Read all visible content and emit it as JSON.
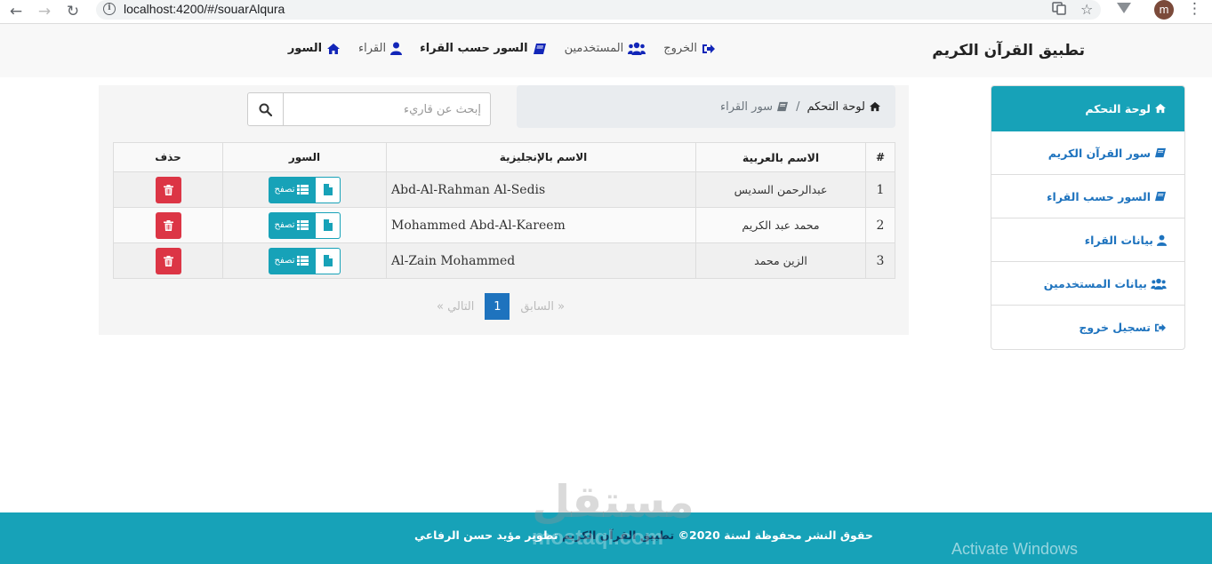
{
  "browser": {
    "url": "localhost:4200/#/souarAlqura",
    "avatar_letter": "m"
  },
  "navbar": {
    "brand": "تطبيق القرآن الكريم",
    "links": [
      {
        "label": "السور",
        "icon": "home-icon",
        "bold": true
      },
      {
        "label": "القراء",
        "icon": "user-icon",
        "bold": false
      },
      {
        "label": "السور حسب القراء",
        "icon": "book-icon",
        "bold": true
      },
      {
        "label": "المستخدمين",
        "icon": "users-icon",
        "bold": false
      },
      {
        "label": "الخروج",
        "icon": "sign-out-icon",
        "bold": false
      }
    ]
  },
  "sidebar": {
    "items": [
      {
        "label": "لوحة التحكم",
        "icon": "home-icon",
        "active": true
      },
      {
        "label": "سور القرآن الكريم",
        "icon": "book-icon",
        "active": false
      },
      {
        "label": "السور حسب القراء",
        "icon": "book-icon",
        "active": false
      },
      {
        "label": "بيانات القراء",
        "icon": "user-icon",
        "active": false
      },
      {
        "label": "بيانات المستخدمين",
        "icon": "users-icon",
        "active": false
      },
      {
        "label": "تسجيل خروج",
        "icon": "sign-out-icon",
        "active": false
      }
    ]
  },
  "breadcrumb": {
    "home": "لوحة التحكم",
    "current": "سور القراء"
  },
  "search": {
    "placeholder": "إبحث عن قاريء"
  },
  "table": {
    "headers": {
      "num": "#",
      "arabic_name": "الاسم بالعربية",
      "english_name": "الاسم بالإنجليزية",
      "sour": "السور",
      "delete": "حذف"
    },
    "browse_label": "تصفح",
    "rows": [
      {
        "num": "1",
        "arabic_name": "عبدالرحمن السديس",
        "english_name": "Abd-Al-Rahman Al-Sedis"
      },
      {
        "num": "2",
        "arabic_name": "محمد عبد الكريم",
        "english_name": "Mohammed Abd-Al-Kareem"
      },
      {
        "num": "3",
        "arabic_name": "الزين محمد",
        "english_name": "Al-Zain Mohammed"
      }
    ]
  },
  "pagination": {
    "prev": "« السابق",
    "current": "1",
    "next": "التالي »"
  },
  "footer": {
    "text_before": "حقوق النشر محفوظة لسنة 2020©",
    "app_name": "تطبيق القرآن الكريم",
    "text_after": "تطوير مؤيد حسن الرفاعي"
  },
  "overlays": {
    "watermark": "مستقل",
    "watermark_sub": "mostaql.com",
    "activate_windows": "Activate Windows"
  },
  "colors": {
    "accent": "#17a2b8",
    "link": "#1e73be",
    "danger": "#dc3545",
    "nav_icon": "#1226b8"
  }
}
